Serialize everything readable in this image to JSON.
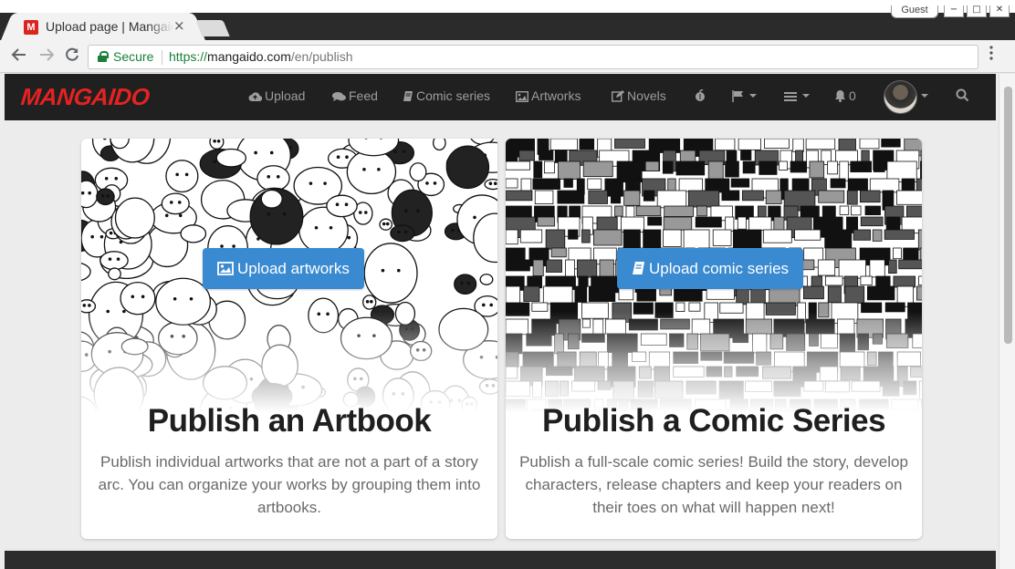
{
  "browser": {
    "tab_title": "Upload page | Mangaido",
    "favicon_letter": "M",
    "close_symbol": "×",
    "guest_label": "Guest",
    "secure_label": "Secure",
    "url_scheme": "https://",
    "url_host": "mangaido.com",
    "url_path": "/en/publish",
    "window_buttons": [
      "−",
      "□",
      "✕"
    ],
    "icons": [
      "back-arrow-icon",
      "forward-arrow-icon",
      "reload-icon",
      "lock-icon",
      "menu-dots-icon"
    ]
  },
  "site_nav": {
    "logo": "MANGAIDO",
    "items": [
      {
        "label": "Upload",
        "icon": "cloud-upload-icon"
      },
      {
        "label": "Feed",
        "icon": "comments-icon"
      },
      {
        "label": "Comic series",
        "icon": "book-icon"
      },
      {
        "label": "Artworks",
        "icon": "image-icon"
      },
      {
        "label": "Novels",
        "icon": "edit-icon"
      }
    ],
    "notifications_count": "0",
    "icons": [
      "fruit-icon",
      "flag-icon",
      "bars-icon",
      "bell-icon",
      "search-icon"
    ],
    "bg_color": "#202020",
    "logo_color": "#e52222"
  },
  "cards": [
    {
      "button_label": "Upload artworks",
      "heading": "Publish an Artbook",
      "description": "Publish individual artworks that are not a part of a story arc. You can organize your works by grouping them into artbooks."
    },
    {
      "button_label": "Upload comic series",
      "heading": "Publish a Comic Series",
      "description": "Publish a full-scale comic series! Build the story, develop characters, release chapters and keep your readers on their toes on what will happen next!"
    }
  ],
  "colors": {
    "accent_button": "#3a8ad1",
    "secure_green": "#188038"
  }
}
